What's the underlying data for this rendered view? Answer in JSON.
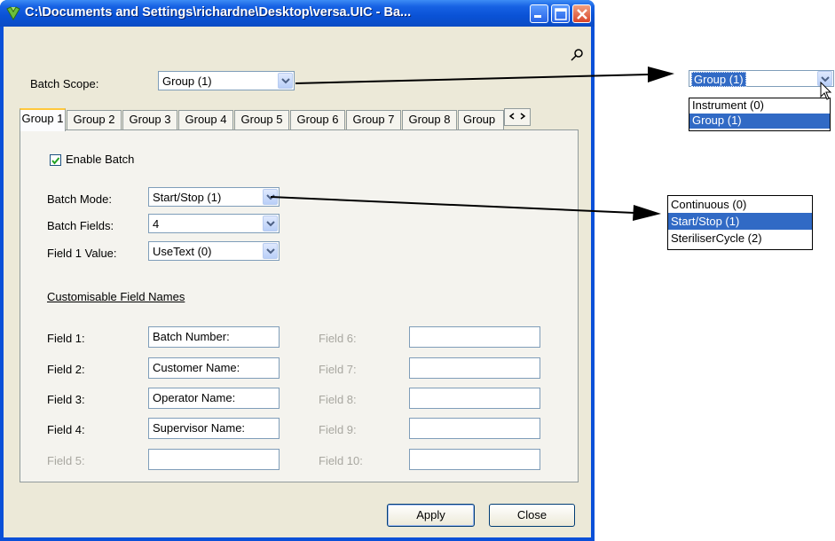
{
  "window": {
    "title": "C:\\Documents and Settings\\richardne\\Desktop\\versa.UIC - Ba...",
    "buttons": {
      "minimize": "minimize",
      "maximize": "maximize",
      "close": "close"
    }
  },
  "batch_scope": {
    "label": "Batch Scope:",
    "value": "Group (1)"
  },
  "tabs": [
    {
      "label": "Group 1",
      "active": true
    },
    {
      "label": "Group 2"
    },
    {
      "label": "Group 3"
    },
    {
      "label": "Group 4"
    },
    {
      "label": "Group 5"
    },
    {
      "label": "Group 6"
    },
    {
      "label": "Group 7"
    },
    {
      "label": "Group 8"
    },
    {
      "label": "Group"
    }
  ],
  "enable_batch": {
    "label": "Enable Batch",
    "checked": true
  },
  "batch_mode": {
    "label": "Batch Mode:",
    "value": "Start/Stop (1)"
  },
  "batch_fields": {
    "label": "Batch Fields:",
    "value": "4"
  },
  "field1_value": {
    "label": "Field 1 Value:",
    "value": "UseText (0)"
  },
  "custom_section": {
    "heading": "Customisable Field Names"
  },
  "fields": [
    {
      "label": "Field 1:",
      "value": "Batch Number:",
      "enabled": true
    },
    {
      "label": "Field 2:",
      "value": "Customer Name:",
      "enabled": true
    },
    {
      "label": "Field 3:",
      "value": "Operator Name:",
      "enabled": true
    },
    {
      "label": "Field 4:",
      "value": "Supervisor Name:",
      "enabled": true
    },
    {
      "label": "Field 5:",
      "value": "",
      "enabled": false
    },
    {
      "label": "Field 6:",
      "value": "",
      "enabled": false
    },
    {
      "label": "Field 7:",
      "value": "",
      "enabled": false
    },
    {
      "label": "Field 8:",
      "value": "",
      "enabled": false
    },
    {
      "label": "Field 9:",
      "value": "",
      "enabled": false
    },
    {
      "label": "Field 10:",
      "value": "",
      "enabled": false
    }
  ],
  "buttons": {
    "apply": "Apply",
    "close": "Close"
  },
  "callout_scope": {
    "selected": "Group (1)",
    "options": [
      {
        "label": "Instrument (0)",
        "selected": false
      },
      {
        "label": "Group (1)",
        "selected": true
      }
    ]
  },
  "callout_mode": {
    "options": [
      {
        "label": "Continuous (0)",
        "selected": false
      },
      {
        "label": "Start/Stop (1)",
        "selected": true
      },
      {
        "label": "SteriliserCycle (2)",
        "selected": false
      }
    ]
  },
  "colors": {
    "titlebar": "#0a52d6",
    "selection": "#316ac5",
    "tab_highlight": "#ffc83c"
  }
}
